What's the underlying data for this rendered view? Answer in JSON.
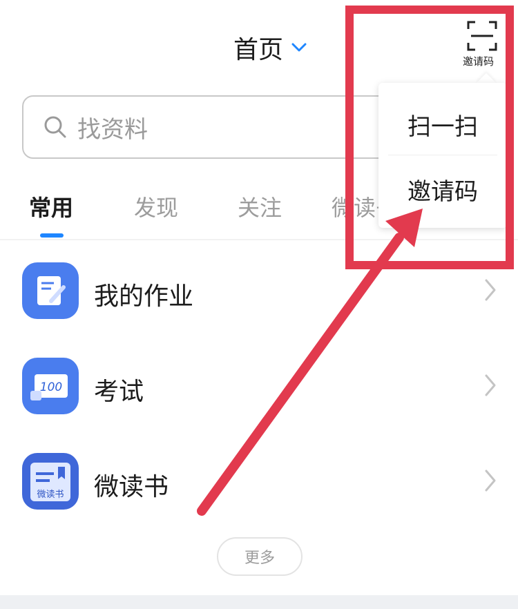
{
  "header": {
    "title": "首页",
    "title_dropdown_icon": "chevron-down-icon",
    "scan_icon": "scan-frame-icon",
    "scan_label": "邀请码"
  },
  "search": {
    "icon": "search-icon",
    "placeholder": "找资料"
  },
  "tabs": [
    {
      "label": "常用",
      "active": true
    },
    {
      "label": "发现",
      "active": false
    },
    {
      "label": "关注",
      "active": false
    },
    {
      "label": "微读书",
      "active": false
    }
  ],
  "list": [
    {
      "label": "我的作业",
      "icon": "homework-icon"
    },
    {
      "label": "考试",
      "icon": "exam-100-icon",
      "icon_text": "100"
    },
    {
      "label": "微读书",
      "icon": "book-icon",
      "icon_text": "微读书"
    }
  ],
  "more_label": "更多",
  "dropdown": {
    "items": [
      "扫一扫",
      "邀请码"
    ]
  },
  "colors": {
    "accent": "#1e86ff",
    "icon_blue": "#4a7dee",
    "annotation_red": "#e23a4e"
  }
}
